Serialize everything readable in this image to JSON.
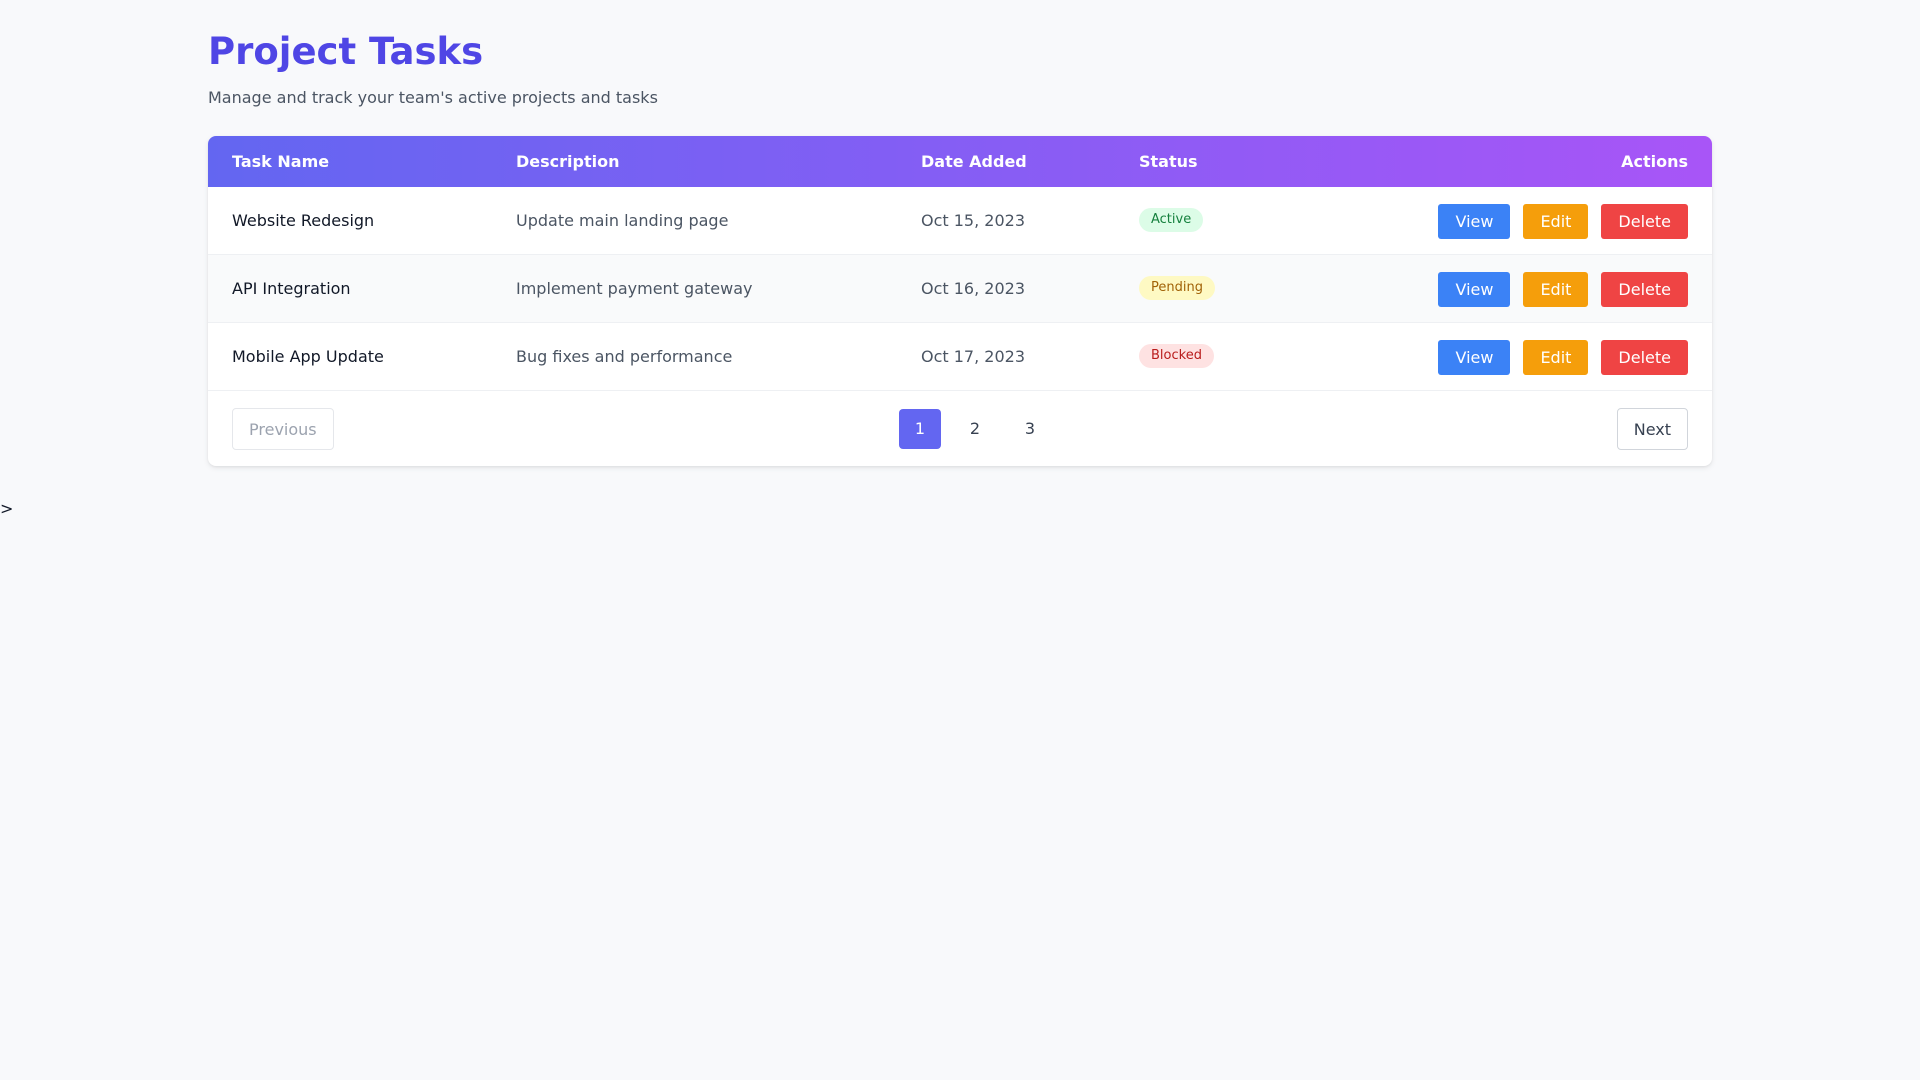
{
  "header": {
    "title": "Project Tasks",
    "subtitle": "Manage and track your team's active projects and tasks"
  },
  "table": {
    "columns": [
      "Task Name",
      "Description",
      "Date Added",
      "Status",
      "Actions"
    ],
    "rows": [
      {
        "name": "Website Redesign",
        "description": "Update main landing page",
        "date": "Oct 15, 2023",
        "status": "Active"
      },
      {
        "name": "API Integration",
        "description": "Implement payment gateway",
        "date": "Oct 16, 2023",
        "status": "Pending"
      },
      {
        "name": "Mobile App Update",
        "description": "Bug fixes and performance",
        "date": "Oct 17, 2023",
        "status": "Blocked"
      }
    ],
    "actions": {
      "view": "View",
      "edit": "Edit",
      "delete": "Delete"
    }
  },
  "pagination": {
    "previous": "Previous",
    "next": "Next",
    "pages": [
      "1",
      "2",
      "3"
    ],
    "current": "1"
  },
  "stray_text": ">",
  "colors": {
    "accent": "#4f46e5",
    "header_gradient_start": "#6366f1",
    "header_gradient_end": "#a855f7",
    "view": "#3b82f6",
    "edit": "#f59e0b",
    "delete": "#ef4444",
    "status_active_bg": "#dcfce7",
    "status_active_text": "#15803d",
    "status_pending_bg": "#fef9c3",
    "status_pending_text": "#a16207",
    "status_blocked_bg": "#fee2e2",
    "status_blocked_text": "#b91c1c"
  }
}
